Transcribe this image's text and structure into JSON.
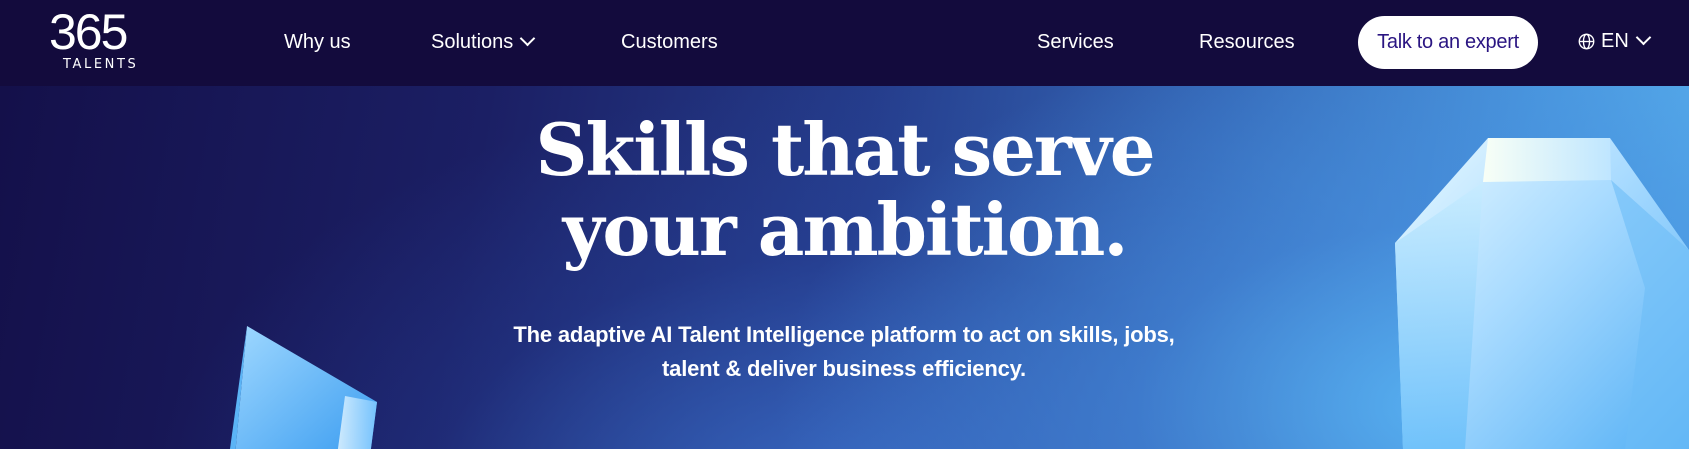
{
  "brand": {
    "logo_number": "365",
    "logo_subtext": "TALENTS"
  },
  "nav": {
    "why_us": "Why us",
    "solutions": "Solutions",
    "customers": "Customers",
    "services": "Services",
    "resources": "Resources",
    "cta": "Talk to an expert",
    "language": "EN"
  },
  "hero": {
    "title_line1": "Skills that serve",
    "title_line2": "your ambition.",
    "subtitle_line1": "The adaptive AI Talent Intelligence platform to act on skills, jobs,",
    "subtitle_line2": "talent & deliver business efficiency."
  },
  "colors": {
    "nav_background": "#130b3d",
    "cta_text": "#2a1582",
    "cta_background": "#ffffff",
    "hero_gradient_start": "#14104a",
    "hero_gradient_end": "#58b0ee"
  },
  "icons": {
    "globe": "globe-icon",
    "chevron": "chevron-down-icon"
  }
}
